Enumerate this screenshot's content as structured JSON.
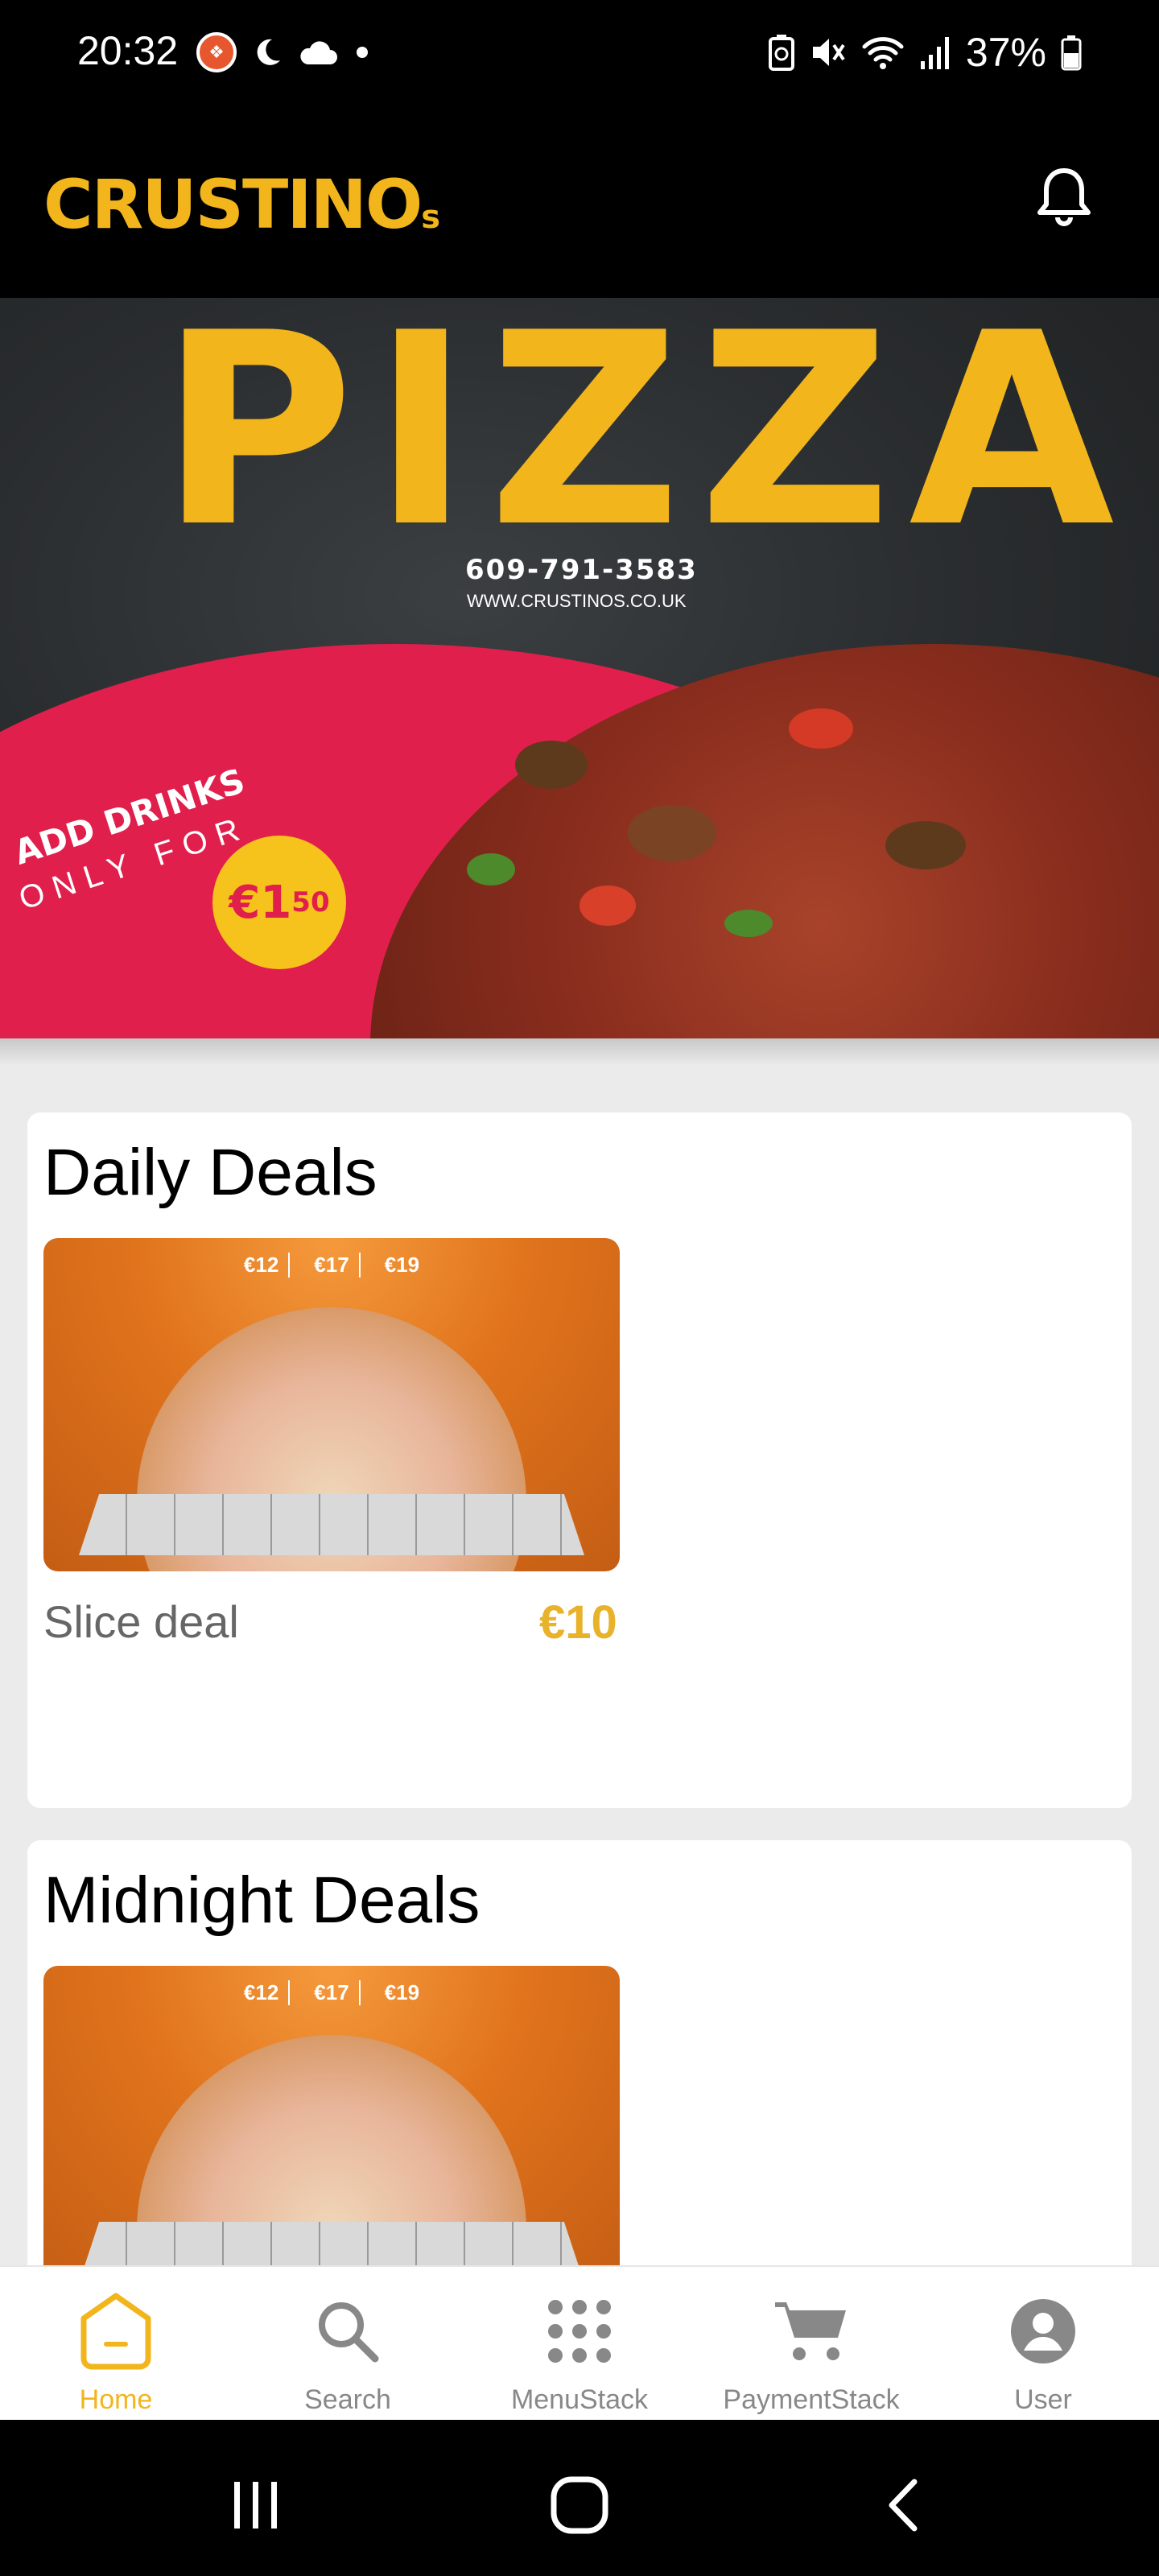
{
  "status_bar": {
    "time": "20:32",
    "battery": "37%",
    "icons": [
      "app-notification-icon",
      "moon-icon",
      "cloud-icon",
      "dot-icon",
      "battery-saver-icon",
      "mute-icon",
      "wifi-icon",
      "signal-icon",
      "battery-icon"
    ]
  },
  "header": {
    "logo_text": "CRUSTINO",
    "logo_suffix": "s",
    "bell_icon": "bell-icon"
  },
  "banner": {
    "title": "PIZZA",
    "phone": "609-791-3583",
    "website": "WWW.CRUSTINOS.CO.UK",
    "promo_line1": "ADD DRINKS",
    "promo_line2": "ONLY FOR",
    "promo_price": "€1",
    "promo_price_cents": "50"
  },
  "sections": [
    {
      "title": "Daily Deals",
      "items": [
        {
          "name": "Slice deal",
          "price": "€10",
          "image_prices": [
            "€12",
            "€17",
            "€19"
          ]
        }
      ]
    },
    {
      "title": "Midnight Deals",
      "items": [
        {
          "image_prices": [
            "€12",
            "€17",
            "€19"
          ]
        }
      ]
    }
  ],
  "bottom_nav": [
    {
      "label": "Home",
      "icon": "home-icon",
      "active": true
    },
    {
      "label": "Search",
      "icon": "search-icon",
      "active": false
    },
    {
      "label": "MenuStack",
      "icon": "grid-icon",
      "active": false
    },
    {
      "label": "PaymentStack",
      "icon": "cart-icon",
      "active": false
    },
    {
      "label": "User",
      "icon": "user-icon",
      "active": false
    }
  ],
  "colors": {
    "brand_yellow": "#f2b51c",
    "promo_red": "#e01f4c",
    "price_gold": "#e8b32a"
  }
}
